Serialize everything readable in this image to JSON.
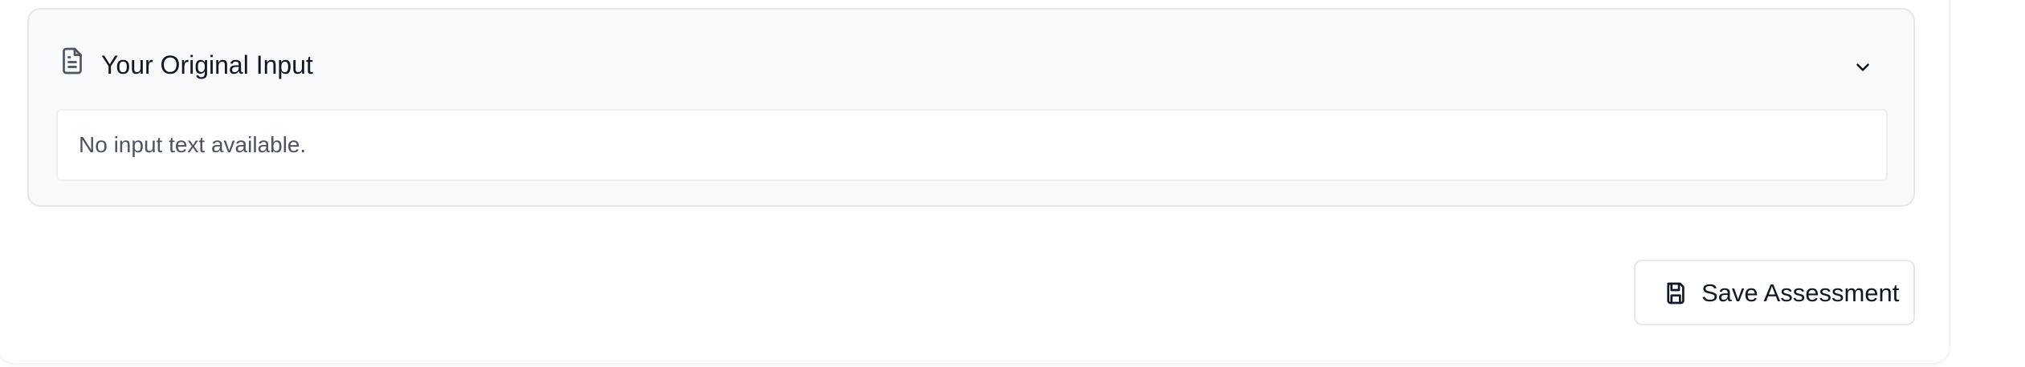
{
  "input_section": {
    "title": "Your Original Input",
    "content": "No input text available.",
    "icons": {
      "header": "document-icon",
      "toggle": "chevron-down-icon"
    }
  },
  "actions": {
    "save_label": "Save Assessment",
    "save_icon": "save-icon"
  },
  "colors": {
    "section_background": "#f8f9fb",
    "border": "#e5e7eb",
    "primary_text": "#111827",
    "muted_text": "#4b5563",
    "panel_background": "#ffffff"
  }
}
